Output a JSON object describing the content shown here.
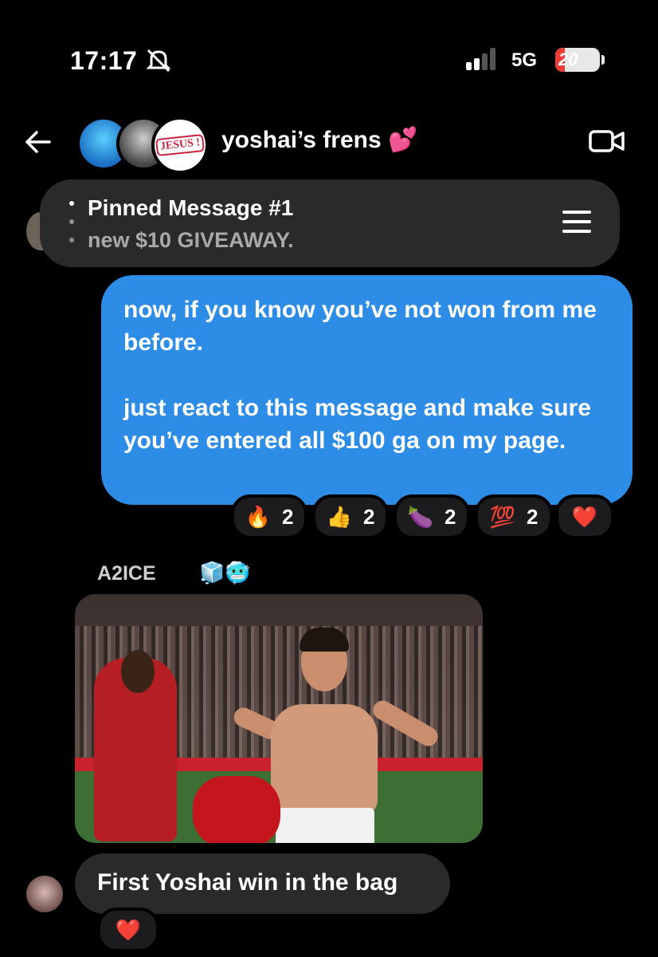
{
  "status_bar": {
    "time": "17:17",
    "network": "5G",
    "battery": "20"
  },
  "header": {
    "title": "yoshai’s frens 💕",
    "avatar3_text": "JESUS !"
  },
  "pinned": {
    "title": "Pinned Message #1",
    "subtitle": "new $10 GIVEAWAY."
  },
  "outgoing_message": {
    "paragraphs": [
      "now, if you know you’ve not won from me before.",
      "just react to this message and make sure you’ve entered all $100 ga on my page."
    ]
  },
  "reactions": [
    {
      "emoji": "🔥",
      "count": "2"
    },
    {
      "emoji": "👍",
      "count": "2"
    },
    {
      "emoji": "🍆",
      "count": "2"
    },
    {
      "emoji": "💯",
      "count": "2"
    },
    {
      "emoji": "❤️",
      "count": ""
    }
  ],
  "incoming": {
    "sender": "A2ICE",
    "sender_emojis": "🧊🥶",
    "text": "First Yoshai win in the bag",
    "reaction": "❤️"
  },
  "icons": {
    "back": "arrow-left-icon",
    "bell": "bell-slash-icon",
    "video": "video-camera-icon",
    "menu": "hamburger-menu-icon"
  }
}
